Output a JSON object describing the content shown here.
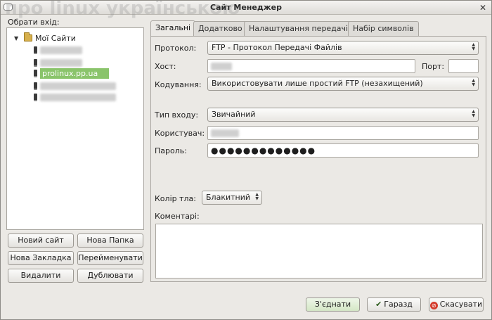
{
  "window": {
    "title": "Сайт Менеджер",
    "watermark": "про linux українською"
  },
  "sidebar": {
    "label": "Обрати вхід:",
    "root": "Мої Сайти",
    "sites": [
      {
        "label": ""
      },
      {
        "label": ""
      },
      {
        "label": "prolinux.pp.ua"
      },
      {
        "label": ""
      },
      {
        "label": ""
      }
    ],
    "buttons": {
      "new_site": "Новий сайт",
      "new_folder": "Нова Папка",
      "new_bookmark": "Нова Закладка",
      "rename": "Перейменувати",
      "delete": "Видалити",
      "duplicate": "Дублювати"
    }
  },
  "tabs": [
    {
      "label": "Загальні",
      "active": true
    },
    {
      "label": "Додатково",
      "active": false
    },
    {
      "label": "Налаштування передачі",
      "active": false
    },
    {
      "label": "Набір символів",
      "active": false
    }
  ],
  "general": {
    "protocol_label": "Протокол:",
    "protocol_value": "FTP - Протокол Передачі Файлів",
    "host_label": "Хост:",
    "host_value": "",
    "port_label": "Порт:",
    "port_value": "",
    "encoding_label": "Кодування:",
    "encoding_value": "Використовувати лише простий FTP (незахищений)",
    "logon_label": "Тип входу:",
    "logon_value": "Звичайний",
    "user_label": "Користувач:",
    "user_value": "",
    "password_label": "Пароль:",
    "password_value": "●●●●●●●●●●●●●",
    "bg_label": "Колір тла:",
    "bg_value": "Блакитний",
    "comments_label": "Коментарі:",
    "comments_value": ""
  },
  "footer": {
    "connect": "З'єднати",
    "ok": "Гаразд",
    "cancel": "Скасувати"
  },
  "colors": {
    "selection": "#8ac46b",
    "window_bg": "#ebe9e5"
  },
  "icons": [
    "folder-icon",
    "server-icon",
    "check-icon",
    "cancel-icon",
    "close-icon"
  ]
}
